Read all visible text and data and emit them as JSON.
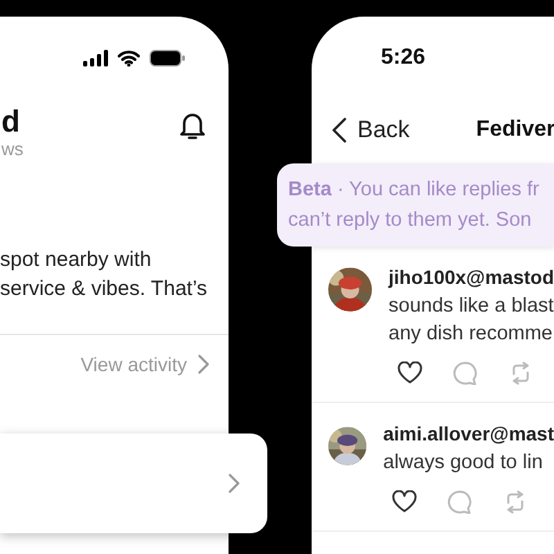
{
  "left_screen": {
    "title": "d",
    "subtitle": "ws",
    "post_lines": [
      "spot nearby with",
      "service & vibes. That’s"
    ],
    "view_activity": "View activity"
  },
  "right_screen": {
    "status_bar": {
      "time": "5:26"
    },
    "nav": {
      "back": "Back",
      "title": "Fediver"
    },
    "banner": {
      "lines": [
        "**Beta** · You can like replies fr",
        "can’t reply to them yet. Son"
      ]
    },
    "replies": [
      {
        "handle": "jiho100x@mastod",
        "lines": [
          "sounds like a blast",
          "any dish recomme"
        ],
        "avatar": {
          "kind": "picture"
        }
      },
      {
        "handle": "aimi.allover@mast",
        "lines": [
          "always good to lin"
        ],
        "avatar": {
          "kind": "picture"
        }
      }
    ]
  }
}
